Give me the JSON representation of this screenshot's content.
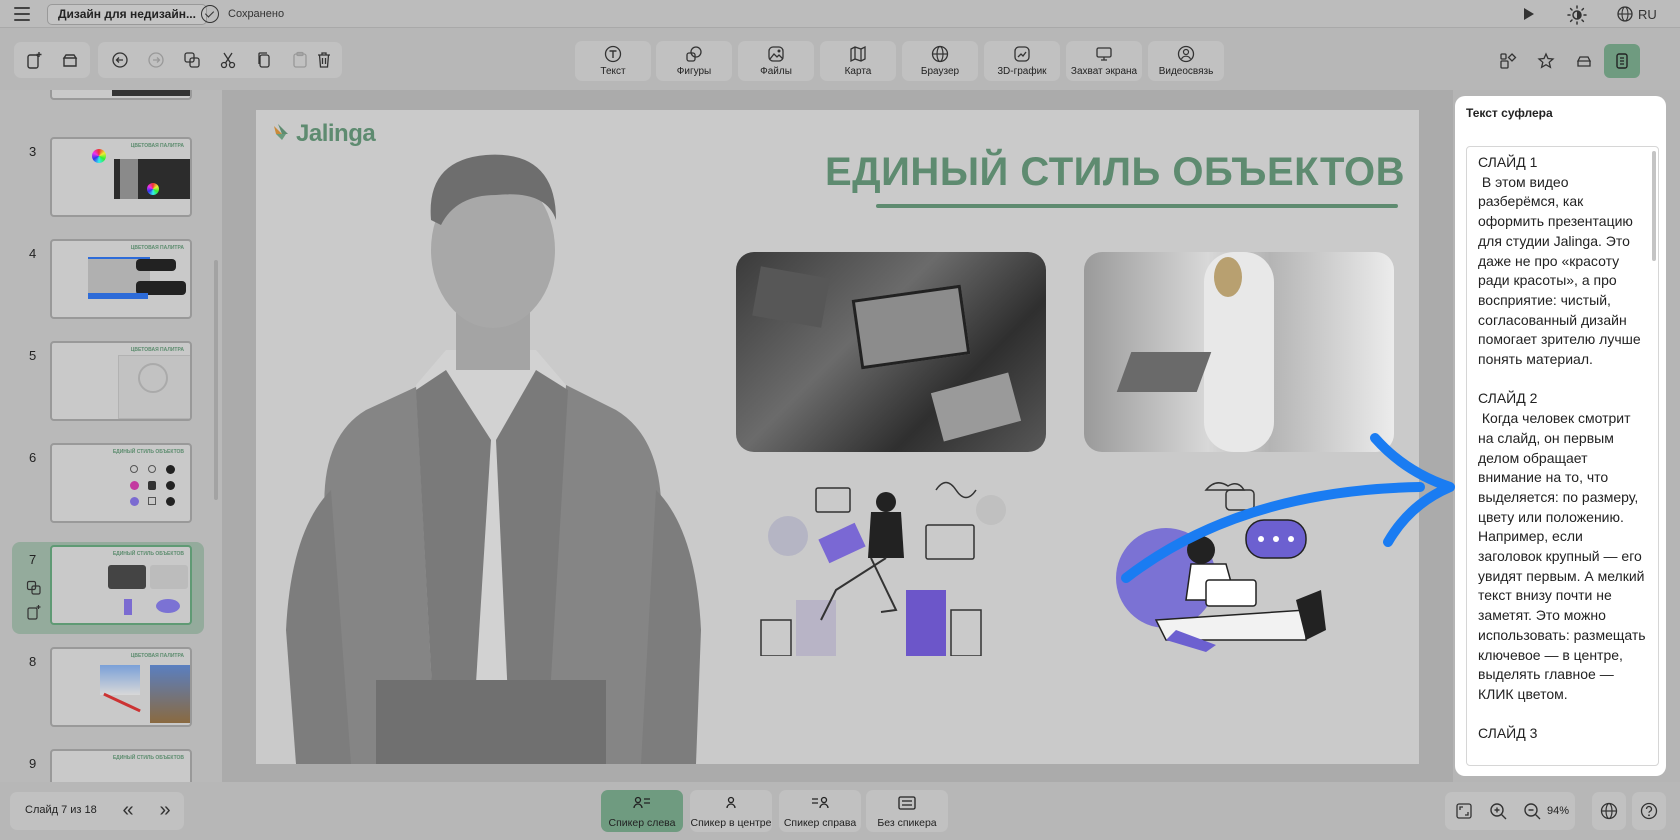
{
  "header": {
    "document_title": "Дизайн для недизайн...",
    "save_status": "Сохранено",
    "language": "RU"
  },
  "toolbar": {
    "tools": [
      {
        "label": "Текст",
        "icon": "text-icon"
      },
      {
        "label": "Фигуры",
        "icon": "shapes-icon"
      },
      {
        "label": "Файлы",
        "icon": "files-icon"
      },
      {
        "label": "Карта",
        "icon": "map-icon"
      },
      {
        "label": "Браузер",
        "icon": "browser-icon"
      },
      {
        "label": "3D-график",
        "icon": "chart-icon"
      },
      {
        "label": "Захват экрана",
        "icon": "screen-capture-icon"
      },
      {
        "label": "Видеосвязь",
        "icon": "video-call-icon"
      }
    ]
  },
  "slides": {
    "items": [
      {
        "number": "3",
        "title": "ЦВЕТОВАЯ ПАЛИТРА"
      },
      {
        "number": "4",
        "title": "ЦВЕТОВАЯ ПАЛИТРА"
      },
      {
        "number": "5",
        "title": "ЦВЕТОВАЯ ПАЛИТРА"
      },
      {
        "number": "6",
        "title": "ЕДИНЫЙ СТИЛЬ ОБЪЕКТОВ"
      },
      {
        "number": "7",
        "title": "ЕДИНЫЙ СТИЛЬ ОБЪЕКТОВ"
      },
      {
        "number": "8",
        "title": "ЦВЕТОВАЯ ПАЛИТРА"
      },
      {
        "number": "9",
        "title": "ЕДИНЫЙ СТИЛЬ ОБЪЕКТОВ"
      }
    ],
    "active_number": "7"
  },
  "canvas": {
    "logo_text": "Jalinga",
    "title": "ЕДИНЫЙ СТИЛЬ ОБЪЕКТОВ"
  },
  "prompter": {
    "title": "Текст суфлера",
    "text": "СЛАЙД 1\n В этом видео разберёмся, как оформить презентацию для студии Jalinga. Это даже не про «красоту ради красоты», а про восприятие: чистый, согласованный дизайн помогает зрителю лучше понять материал.\n\nСЛАЙД 2\n Когда человек смотрит на слайд, он первым делом обращает внимание на то, что выделяется: по размеру, цвету или положению. Например, если заголовок крупный — его увидят первым. А мелкий текст внизу почти не заметят. Это можно использовать: размещать ключевое — в центре, выделять главное — КЛИК цветом.\n\nСЛАЙД 3"
  },
  "footer": {
    "slide_counter": "Слайд 7 из 18",
    "prev": "«",
    "next": "»",
    "layouts": [
      {
        "label": "Спикер слева",
        "active": true
      },
      {
        "label": "Спикер в центре",
        "active": false
      },
      {
        "label": "Спикер справа",
        "active": false
      },
      {
        "label": "Без спикера",
        "active": false
      }
    ],
    "zoom": "94%"
  },
  "colors": {
    "accent_green": "#5e8b70",
    "active_button": "#6f9b80",
    "arrow_blue": "#1a7cf2"
  }
}
